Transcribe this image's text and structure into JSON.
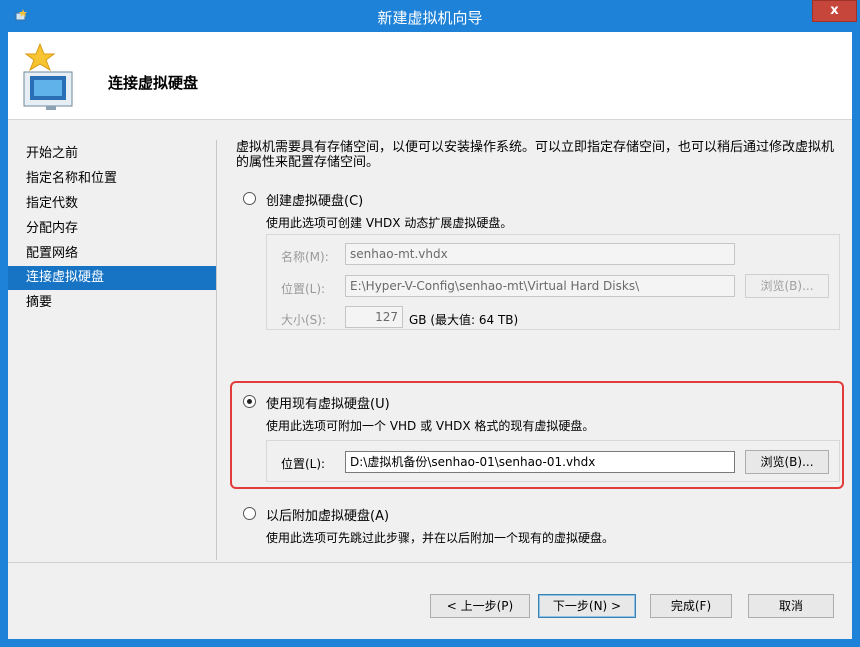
{
  "window": {
    "title": "新建虚拟机向导",
    "close_label": "x"
  },
  "header": {
    "title": "连接虚拟硬盘"
  },
  "nav": {
    "items": [
      {
        "label": "开始之前"
      },
      {
        "label": "指定名称和位置"
      },
      {
        "label": "指定代数"
      },
      {
        "label": "分配内存"
      },
      {
        "label": "配置网络"
      },
      {
        "label": "连接虚拟硬盘",
        "active": true
      },
      {
        "label": "摘要"
      }
    ]
  },
  "content": {
    "intro": "虚拟机需要具有存储空间，以便可以安装操作系统。可以立即指定存储空间，也可以稍后通过修改虚拟机的属性来配置存储空间。",
    "create": {
      "label": "创建虚拟硬盘(C)",
      "desc": "使用此选项可创建 VHDX 动态扩展虚拟硬盘。",
      "name_label": "名称(M):",
      "name_value": "senhao-mt.vhdx",
      "location_label": "位置(L):",
      "location_value": "E:\\Hyper-V-Config\\senhao-mt\\Virtual Hard Disks\\",
      "browse_label": "浏览(B)...",
      "size_label": "大小(S):",
      "size_value": "127",
      "size_unit": "GB (最大值: 64 TB)"
    },
    "use_existing": {
      "label": "使用现有虚拟硬盘(U)",
      "desc": "使用此选项可附加一个 VHD 或 VHDX 格式的现有虚拟硬盘。",
      "location_label": "位置(L):",
      "location_value": "D:\\虚拟机备份\\senhao-01\\senhao-01.vhdx",
      "browse_label": "浏览(B)..."
    },
    "attach_later": {
      "label": "以后附加虚拟硬盘(A)",
      "desc": "使用此选项可先跳过此步骤，并在以后附加一个现有的虚拟硬盘。"
    },
    "selected_option": "use_existing"
  },
  "footer": {
    "prev": "< 上一步(P)",
    "next": "下一步(N) >",
    "finish": "完成(F)",
    "cancel": "取消"
  },
  "colors": {
    "titlebar": "#1e82d8",
    "nav_active": "#1774c5",
    "highlight": "#e23b3b",
    "close": "#c7463b"
  }
}
